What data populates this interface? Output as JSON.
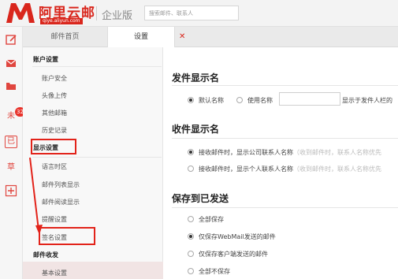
{
  "brand": {
    "name": "阿里云邮",
    "url": "qiye.aliyun.com",
    "edition": "企业版",
    "color": "#d9261c"
  },
  "search": {
    "placeholder": "搜索邮件、联系人"
  },
  "left_bar": {
    "unread_count": "32",
    "draft_glyph": "草",
    "sent_glyph": "已",
    "unread_glyph": "未"
  },
  "tabs": [
    {
      "label": "邮件首页",
      "active": false
    },
    {
      "label": "设置",
      "active": true
    }
  ],
  "settings_nav": {
    "account_heading": "账户设置",
    "account_items": [
      "账户安全",
      "头像上传",
      "其他邮箱",
      "历史记录"
    ],
    "display_heading": "显示设置",
    "display_items": [
      "语言时区",
      "邮件列表显示",
      "邮件阅读显示",
      "提醒设置",
      "签名设置"
    ],
    "mail_heading": "邮件收发",
    "mail_items": [
      "基本设置"
    ]
  },
  "sections": {
    "sender_display": {
      "title": "发件显示名",
      "options": [
        "默认名称",
        "使用名称"
      ],
      "selected": 0,
      "hint": "显示于发件人栏的"
    },
    "receiver_display": {
      "title": "收件显示名",
      "options": [
        {
          "label": "接收邮件时，显示公司联系人名称",
          "hint": "（收到邮件时，联系人名称优先"
        },
        {
          "label": "接收邮件时，显示个人联系人名称",
          "hint": "（收到邮件时，联系人名称优先"
        }
      ],
      "selected": 0
    },
    "save_sent": {
      "title": "保存到已发送",
      "options": [
        "全部保存",
        "仅保存WebMail发送的邮件",
        "仅保存客户端发送的邮件",
        "全部不保存"
      ],
      "selected": 1
    }
  }
}
